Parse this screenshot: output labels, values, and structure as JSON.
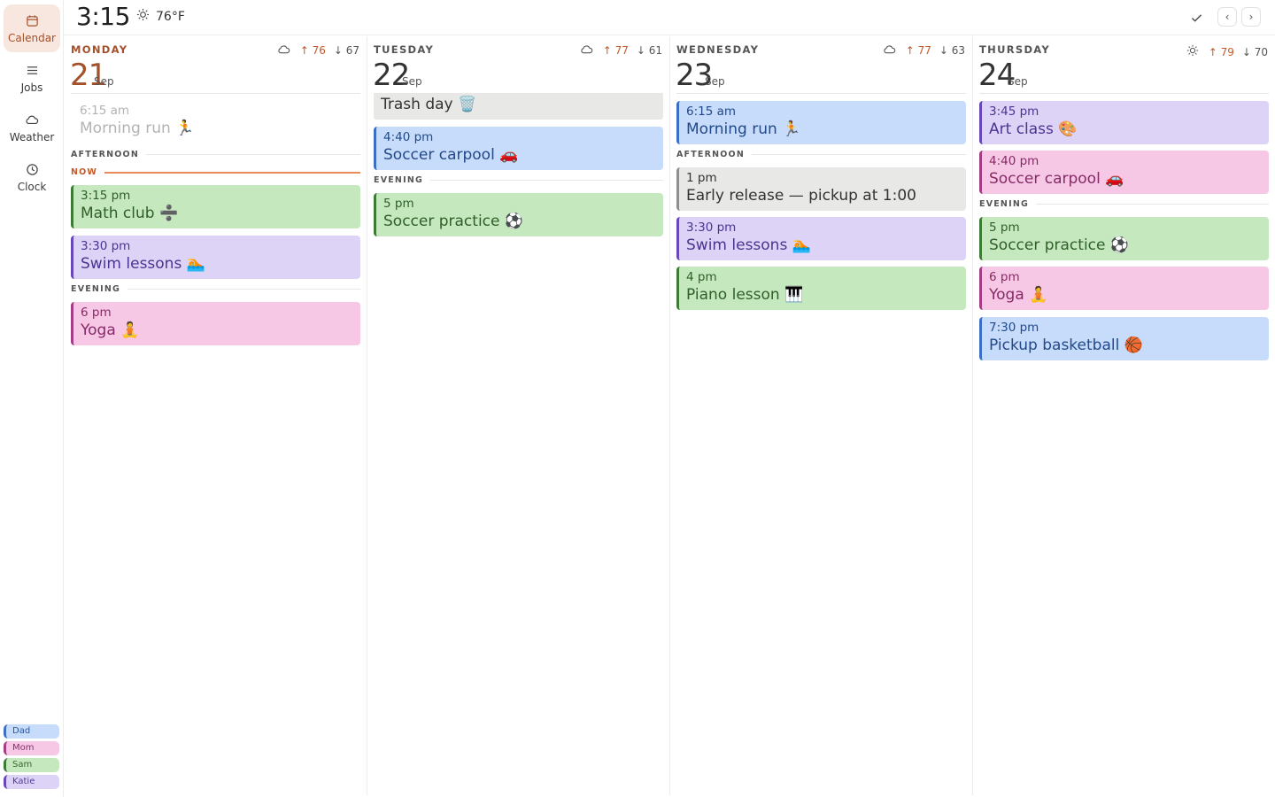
{
  "header": {
    "time": "3:15",
    "temperature": "76°F",
    "weather_icon": "sun-icon"
  },
  "sidebar": {
    "items": [
      {
        "label": "Calendar",
        "icon": "calendar-icon",
        "active": true
      },
      {
        "label": "Jobs",
        "icon": "list-icon"
      },
      {
        "label": "Weather",
        "icon": "cloud-icon"
      },
      {
        "label": "Clock",
        "icon": "clock-icon"
      }
    ],
    "legend": [
      {
        "name": "Dad",
        "color": "#c7dcfb",
        "border": "#3b6fc4"
      },
      {
        "name": "Mom",
        "color": "#f7c8e6",
        "border": "#a43d85"
      },
      {
        "name": "Sam",
        "color": "#c5e8be",
        "border": "#3d7a35"
      },
      {
        "name": "Katie",
        "color": "#dcd3f7",
        "border": "#6848b8"
      }
    ]
  },
  "colors": {
    "dad": "#c7dcfb",
    "mom": "#f7c8e6",
    "sam": "#c5e8be",
    "katie": "#dcd3f7",
    "accent": "#a4502b",
    "now_line": "#e88b5b"
  },
  "sections": {
    "afternoon": "AFTERNOON",
    "evening": "EVENING",
    "now": "NOW"
  },
  "days": [
    {
      "name": "MONDAY",
      "num": "21",
      "month": "Sep",
      "weather": {
        "icon": "cloud-icon",
        "high": "76",
        "low": "67"
      },
      "events": [
        {
          "time": "6:15 am",
          "title": "Morning run 🏃",
          "owner": "dad",
          "past": true
        },
        {
          "time": "3:15 pm",
          "title": "Math club ➗",
          "owner": "sam"
        },
        {
          "time": "3:30 pm",
          "title": "Swim lessons 🏊",
          "owner": "katie"
        },
        {
          "time": "6 pm",
          "title": "Yoga 🧘",
          "owner": "mom"
        }
      ]
    },
    {
      "name": "TUESDAY",
      "num": "22",
      "month": "Sep",
      "weather": {
        "icon": "cloud-icon",
        "high": "77",
        "low": "61"
      },
      "allday": "Trash day 🗑️",
      "events": [
        {
          "time": "4:40 pm",
          "title": "Soccer carpool 🚗",
          "owner": "dad"
        },
        {
          "time": "5 pm",
          "title": "Soccer practice ⚽",
          "owner": "sam"
        }
      ]
    },
    {
      "name": "WEDNESDAY",
      "num": "23",
      "month": "Sep",
      "weather": {
        "icon": "cloud-icon",
        "high": "77",
        "low": "63"
      },
      "events": [
        {
          "time": "6:15 am",
          "title": "Morning run 🏃",
          "owner": "dad"
        },
        {
          "time": "1 pm",
          "title": "Early release — pickup at 1:00",
          "owner": "family"
        },
        {
          "time": "3:30 pm",
          "title": "Swim lessons 🏊",
          "owner": "katie"
        },
        {
          "time": "4 pm",
          "title": "Piano lesson 🎹",
          "owner": "sam"
        }
      ]
    },
    {
      "name": "THURSDAY",
      "num": "24",
      "month": "Sep",
      "weather": {
        "icon": "sun-icon",
        "high": "79",
        "low": "70"
      },
      "events": [
        {
          "time": "3:45 pm",
          "title": "Art class 🎨",
          "owner": "katie"
        },
        {
          "time": "4:40 pm",
          "title": "Soccer carpool 🚗",
          "owner": "mom"
        },
        {
          "time": "5 pm",
          "title": "Soccer practice ⚽",
          "owner": "sam"
        },
        {
          "time": "6 pm",
          "title": "Yoga 🧘",
          "owner": "mom"
        },
        {
          "time": "7:30 pm",
          "title": "Pickup basketball 🏀",
          "owner": "dad"
        }
      ]
    }
  ]
}
